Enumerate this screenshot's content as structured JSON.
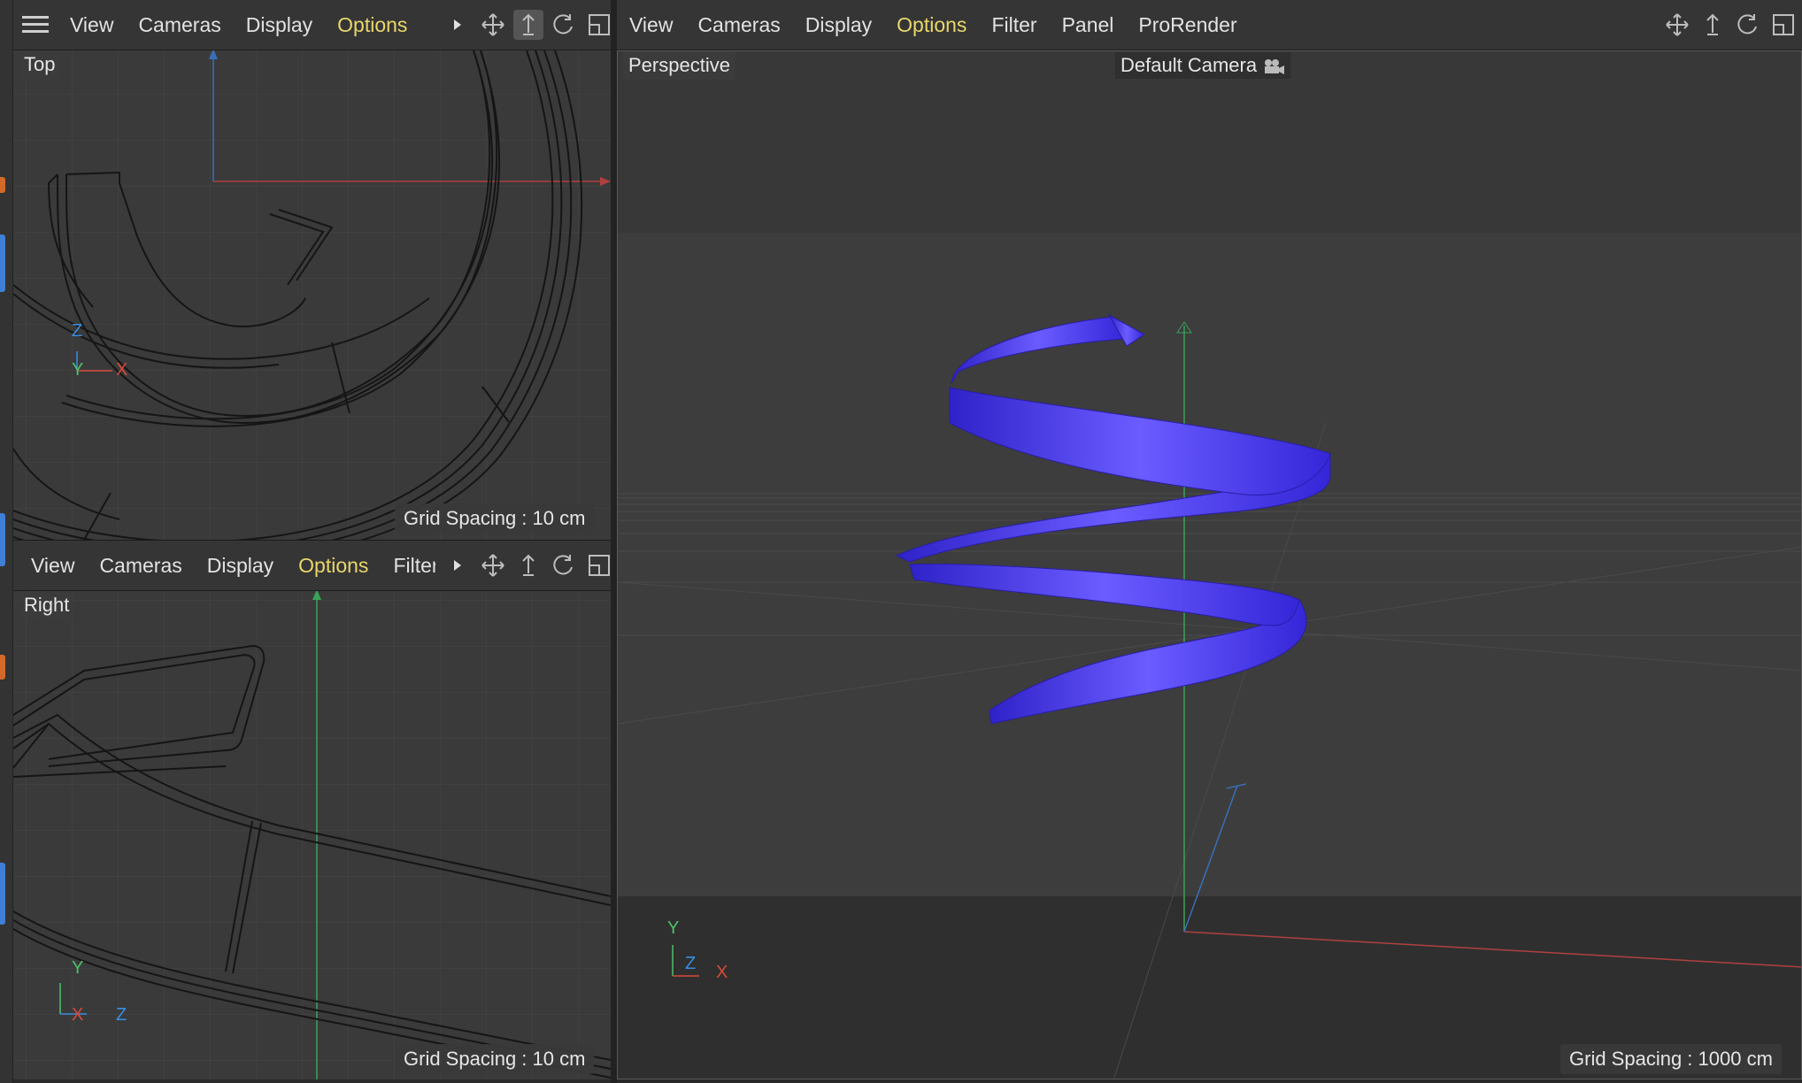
{
  "top_viewport": {
    "menus": [
      "View",
      "Cameras",
      "Display",
      "Options"
    ],
    "active_menu": "Options",
    "label": "Top",
    "grid_spacing": "Grid Spacing : 10 cm",
    "axes": {
      "z": "Z",
      "y": "Y",
      "x": "X"
    }
  },
  "right_viewport": {
    "menus": [
      "View",
      "Cameras",
      "Display",
      "Options",
      "Filter"
    ],
    "active_menu": "Options",
    "label": "Right",
    "grid_spacing": "Grid Spacing : 10 cm",
    "axes": {
      "y": "Y",
      "x": "X",
      "z": "Z"
    }
  },
  "perspective_viewport": {
    "menus": [
      "View",
      "Cameras",
      "Display",
      "Options",
      "Filter",
      "Panel",
      "ProRender"
    ],
    "active_menu": "Options",
    "label": "Perspective",
    "camera": "Default Camera",
    "grid_spacing": "Grid Spacing : 1000 cm",
    "axes": {
      "y": "Y",
      "z": "Z",
      "x": "X"
    }
  },
  "icons": {
    "menu": "hamburger-menu-icon",
    "more": "more-arrow-icon",
    "move": "move-view-icon",
    "scale": "zoom-view-icon",
    "rotate": "rotate-view-icon",
    "maximize": "maximize-view-icon",
    "camera": "camera-icon"
  },
  "colors": {
    "active_menu": "#e9d66b",
    "helix": "#4636f0",
    "axis_x": "#d84a3a",
    "axis_y": "#4ec06a",
    "axis_z": "#3a8ee0"
  }
}
